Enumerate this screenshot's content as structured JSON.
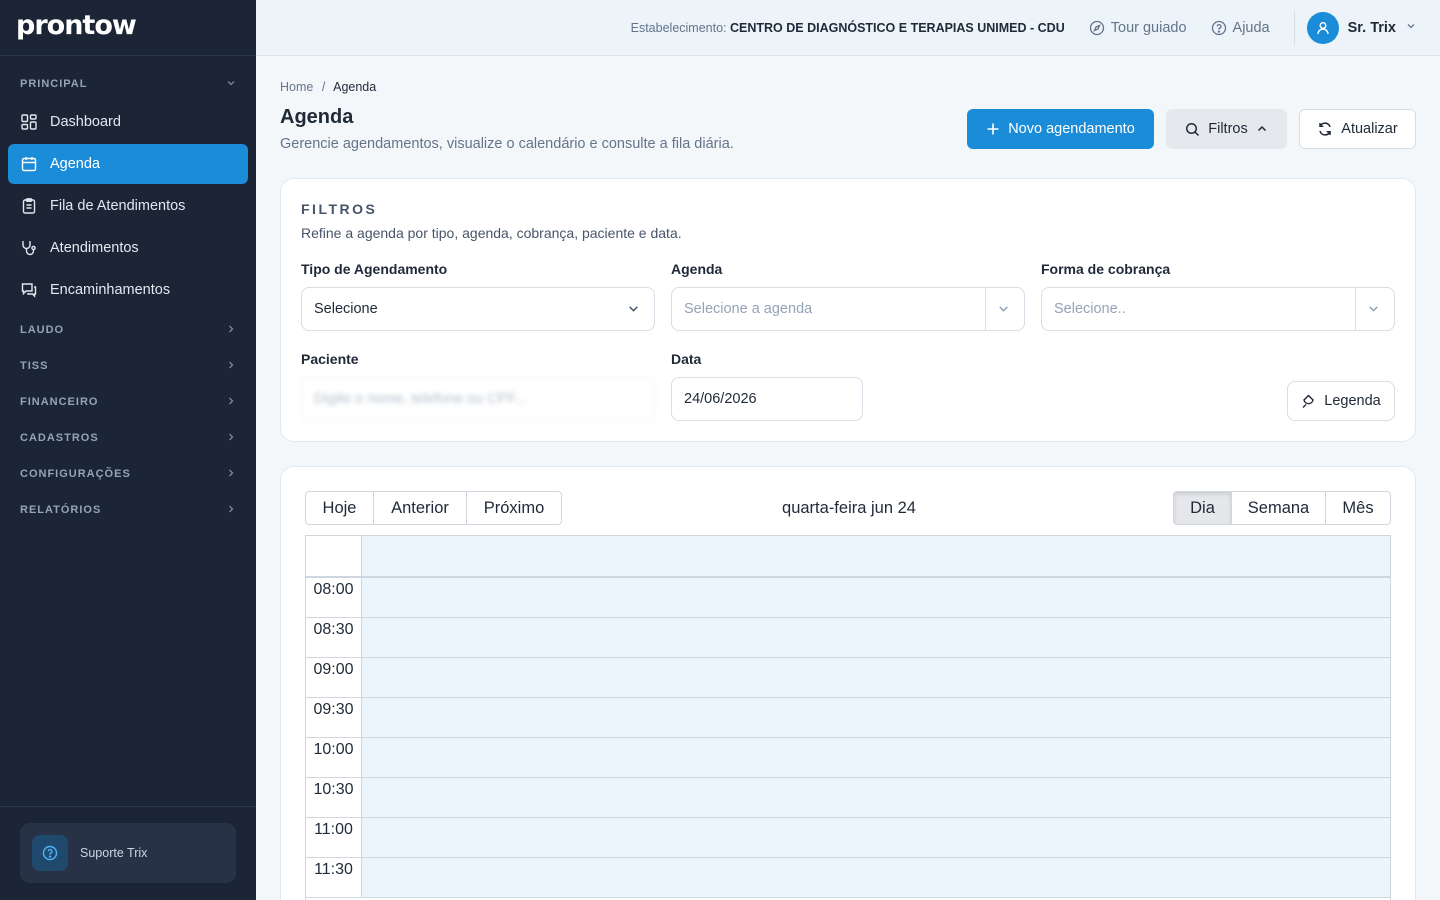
{
  "brand": {
    "logo_text": "prontow"
  },
  "sidebar": {
    "principal_label": "PRINCIPAL",
    "items": [
      {
        "label": "Dashboard",
        "icon": "dashboard-icon",
        "active": false
      },
      {
        "label": "Agenda",
        "icon": "calendar-icon",
        "active": true
      },
      {
        "label": "Fila de Atendimentos",
        "icon": "clipboard-icon",
        "active": false
      },
      {
        "label": "Atendimentos",
        "icon": "stethoscope-icon",
        "active": false
      },
      {
        "label": "Encaminhamentos",
        "icon": "chat-icon",
        "active": false
      }
    ],
    "sections": [
      "LAUDO",
      "TISS",
      "FINANCEIRO",
      "CADASTROS",
      "CONFIGURAÇÕES",
      "RELATÓRIOS"
    ],
    "support_label": "Suporte Trix"
  },
  "topbar": {
    "estab_prefix": "Estabelecimento:",
    "estab_name": "CENTRO DE DIAGNÓSTICO E TERAPIAS UNIMED - CDU",
    "tour_label": "Tour guiado",
    "help_label": "Ajuda",
    "user_name": "Sr. Trix"
  },
  "page": {
    "breadcrumb_home": "Home",
    "breadcrumb_sep": "/",
    "breadcrumb_current": "Agenda",
    "title": "Agenda",
    "subtitle": "Gerencie agendamentos, visualize o calendário e consulte a fila diária.",
    "new_label": "Novo agendamento",
    "filter_label": "Filtros",
    "refresh_label": "Atualizar"
  },
  "filters": {
    "title": "FILTROS",
    "subtitle": "Refine a agenda por tipo, agenda, cobrança, paciente e data.",
    "tipo_label": "Tipo de Agendamento",
    "tipo_value": "Selecione",
    "agenda_label": "Agenda",
    "agenda_placeholder": "Selecione a agenda",
    "cobranca_label": "Forma de cobrança",
    "cobranca_placeholder": "Selecione..",
    "paciente_label": "Paciente",
    "paciente_placeholder": "Digite o nome, telefone ou CPF...",
    "data_label": "Data",
    "data_value": "24/06/2026",
    "legend_label": "Legenda"
  },
  "calendar": {
    "today_label": "Hoje",
    "prev_label": "Anterior",
    "next_label": "Próximo",
    "title": "quarta-feira jun 24",
    "view_day": "Dia",
    "view_week": "Semana",
    "view_month": "Mês",
    "active_view": "Dia",
    "time_slots": [
      "08:00",
      "08:30",
      "09:00",
      "09:30",
      "10:00",
      "10:30",
      "11:00",
      "11:30"
    ]
  },
  "colors": {
    "sidebar_bg": "#1c2536",
    "accent": "#1a8cd8",
    "slot_bg": "#ebf5fd"
  }
}
